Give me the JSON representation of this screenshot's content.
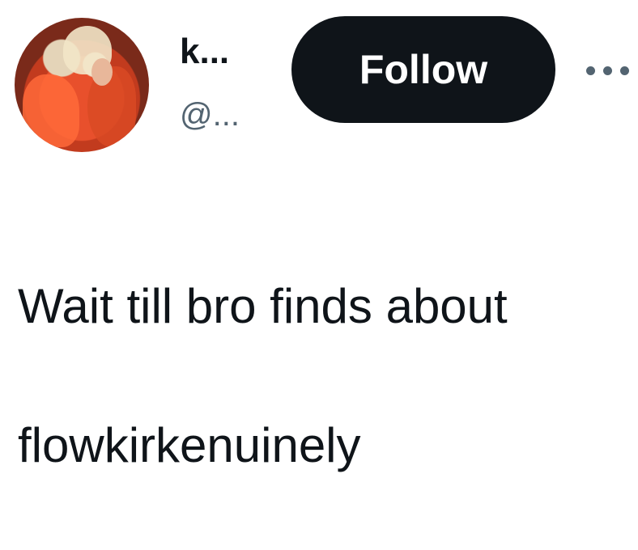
{
  "author": {
    "name": "k...",
    "handle": "@..."
  },
  "follow_button": {
    "label": "Follow"
  },
  "more_menu": {
    "icon": "more-horizontal-icon"
  },
  "tweet": {
    "line1": "Wait till bro finds about",
    "line2": "flowkirkenuinely"
  },
  "colors": {
    "text_primary": "#0f1419",
    "text_secondary": "#536471",
    "button_bg": "#0f1419",
    "button_text": "#ffffff"
  }
}
